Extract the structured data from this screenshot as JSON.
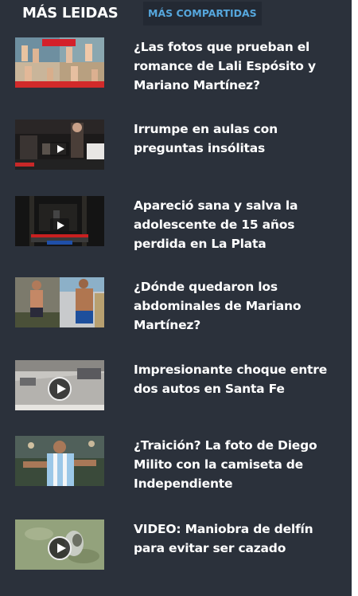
{
  "tabs": {
    "active_label": "MÁS LEIDAS",
    "inactive_label": "MÁS COMPARTIDAS"
  },
  "colors": {
    "panel_bg": "#2b313b",
    "tab_inactive_text": "#56a7dd",
    "headline_text": "#ffffff"
  },
  "articles": [
    {
      "title": "¿Las fotos que prueban el romance de Lali Espósito y Mariano Martínez?",
      "thumbnail": "beach-photos-collage",
      "video": false
    },
    {
      "title": "Irrumpe en aulas con preguntas insólitas",
      "thumbnail": "classroom-video",
      "video": true
    },
    {
      "title": "Apareció sana y salva la adolescente de 15 años perdida en La Plata",
      "thumbnail": "street-night-video",
      "video": true
    },
    {
      "title": "¿Dónde quedaron los abdominales de Mariano Martínez?",
      "thumbnail": "shirtless-man-comparison",
      "video": false
    },
    {
      "title": "Impresionante choque entre dos autos en Santa Fe",
      "thumbnail": "car-crash-cctv-video",
      "video": true
    },
    {
      "title": "¿Traición? La foto de Diego Milito con la camiseta de Independiente",
      "thumbnail": "soccer-player-photo",
      "video": false
    },
    {
      "title": "VIDEO: Maniobra de delfín para evitar ser cazado",
      "thumbnail": "dolphin-water-video",
      "video": true
    }
  ]
}
